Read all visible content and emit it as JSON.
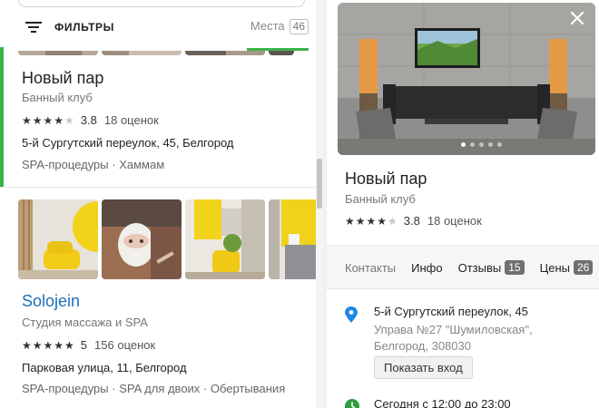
{
  "filter_bar": {
    "filters_label": "ФИЛЬТРЫ",
    "places_tab_label": "Места",
    "places_count": "46"
  },
  "results": [
    {
      "name": "Новый пар",
      "category": "Банный клуб",
      "rating": "3.8",
      "stars": 4,
      "reviews": "18 оценок",
      "address": "5-й Сургутский переулок, 45, Белгород",
      "tags": [
        "SPA-процедуры",
        "Хаммам"
      ]
    },
    {
      "name": "Solojein",
      "category": "Студия массажа и SPA",
      "rating": "5",
      "stars": 5,
      "reviews": "156 оценок",
      "address": "Парковая улица, 11, Белгород",
      "tags": [
        "SPA-процедуры",
        "SPA для двоих",
        "Обертывания"
      ]
    }
  ],
  "detail": {
    "name": "Новый пар",
    "category": "Банный клуб",
    "rating": "3.8",
    "stars": 4,
    "reviews": "18 оценок",
    "tabs": [
      {
        "label": "Контакты"
      },
      {
        "label": "Инфо"
      },
      {
        "label": "Отзывы",
        "badge": "15"
      },
      {
        "label": "Цены",
        "badge": "26"
      }
    ],
    "address_main": "5-й Сургутский переулок, 45",
    "address_extra_1": "Управа №27 \"Шумиловская\",",
    "address_extra_2": "Белгород, 308030",
    "show_entrance": "Показать вход",
    "hours": "Сегодня с 12:00 до 23:00"
  },
  "colors": {
    "accent_green": "#3bb34b",
    "link_blue": "#1a6fb8",
    "pin_blue": "#1e88e5"
  },
  "icons": [
    "filter-icon",
    "close-icon",
    "location-pin-icon",
    "clock-icon",
    "star-icon"
  ]
}
